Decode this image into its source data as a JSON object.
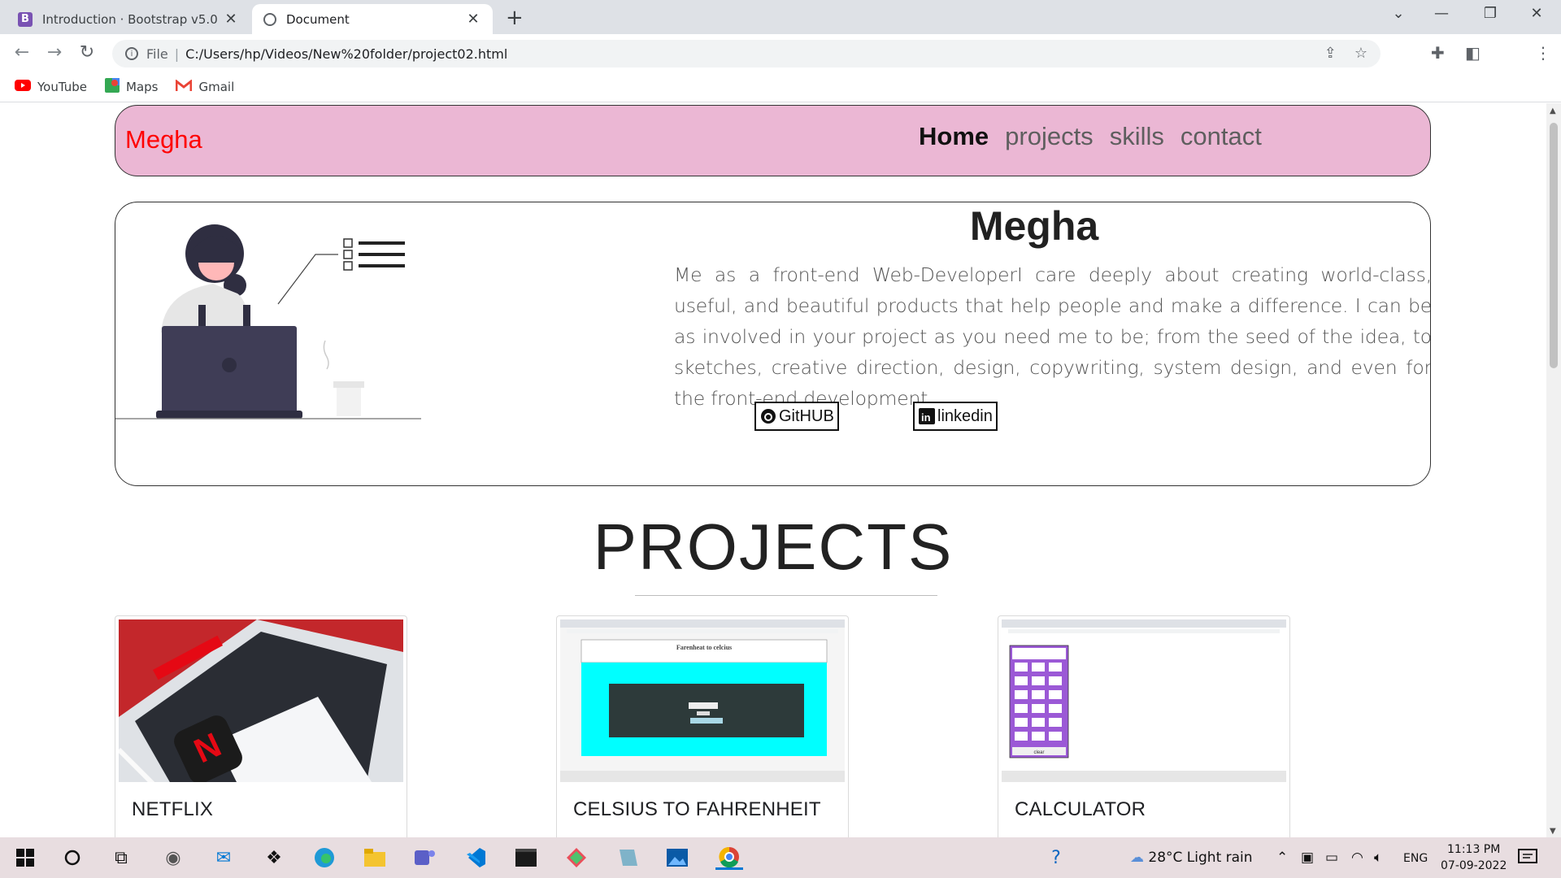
{
  "browser": {
    "tabs": [
      {
        "title": "Introduction · Bootstrap v5.0",
        "favicon": "bootstrap-icon",
        "active": false
      },
      {
        "title": "Document",
        "favicon": "globe-icon",
        "active": true
      }
    ],
    "address": {
      "scheme": "File",
      "url": "C:/Users/hp/Videos/New%20folder/project02.html"
    },
    "bookmarks": [
      {
        "label": "YouTube",
        "icon": "youtube-icon",
        "color": "#ff0000"
      },
      {
        "label": "Maps",
        "icon": "maps-icon",
        "color": "#34a853"
      },
      {
        "label": "Gmail",
        "icon": "gmail-icon",
        "color": "#ea4335"
      }
    ]
  },
  "page": {
    "brand": "Megha",
    "nav": [
      "Home",
      "projects",
      "skills",
      "contact"
    ],
    "hero": {
      "name": "Megha",
      "bio": "Me as a front-end Web-DeveloperI care deeply about creating world-class, useful, and beautiful products that help people and make a difference. I can be as involved in your project as you need me to be; from the seed of the idea, to sketches, creative direction, design, copywriting, system design, and even for the front-end development.",
      "github": "GitHUB",
      "linkedin": "linkedin"
    },
    "projects_heading": "PROJECTS",
    "projects": [
      {
        "title": "NETFLIX"
      },
      {
        "title": "CELSIUS TO FAHRENHEIT",
        "screenshot_heading": "Farenheat to celcius"
      },
      {
        "title": "CALCULATOR",
        "screenshot_button": "clear"
      }
    ]
  },
  "taskbar": {
    "weather": "28°C  Light rain",
    "language": "ENG",
    "time": "11:13 PM",
    "date": "07-09-2022"
  },
  "colors": {
    "navbar_bg": "#ebb7d4",
    "brand_text": "#ff0000",
    "calc_purple": "#9b59d6",
    "celsius_cyan": "#00ffff"
  }
}
